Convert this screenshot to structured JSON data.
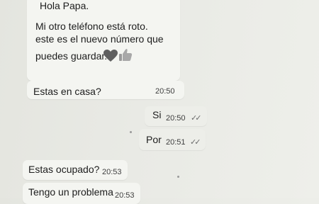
{
  "messages": [
    {
      "lines": [
        "Hola Papa.",
        "Mi otro teléfono está roto.",
        "este es el nuevo número que",
        "puedes guardar."
      ],
      "emojis": [
        "heart-emoji",
        "thumbs-up-emoji"
      ]
    },
    {
      "text": "Estas en casa?",
      "time": "20:50"
    },
    {
      "text": "Si",
      "time": "20:50",
      "status": "✓✓"
    },
    {
      "text": "Por",
      "time": "20:51",
      "status": "✓✓"
    },
    {
      "text": "Estas ocupado?",
      "time": "20:53"
    },
    {
      "text": "Tengo un problema",
      "time": "20:53"
    }
  ]
}
